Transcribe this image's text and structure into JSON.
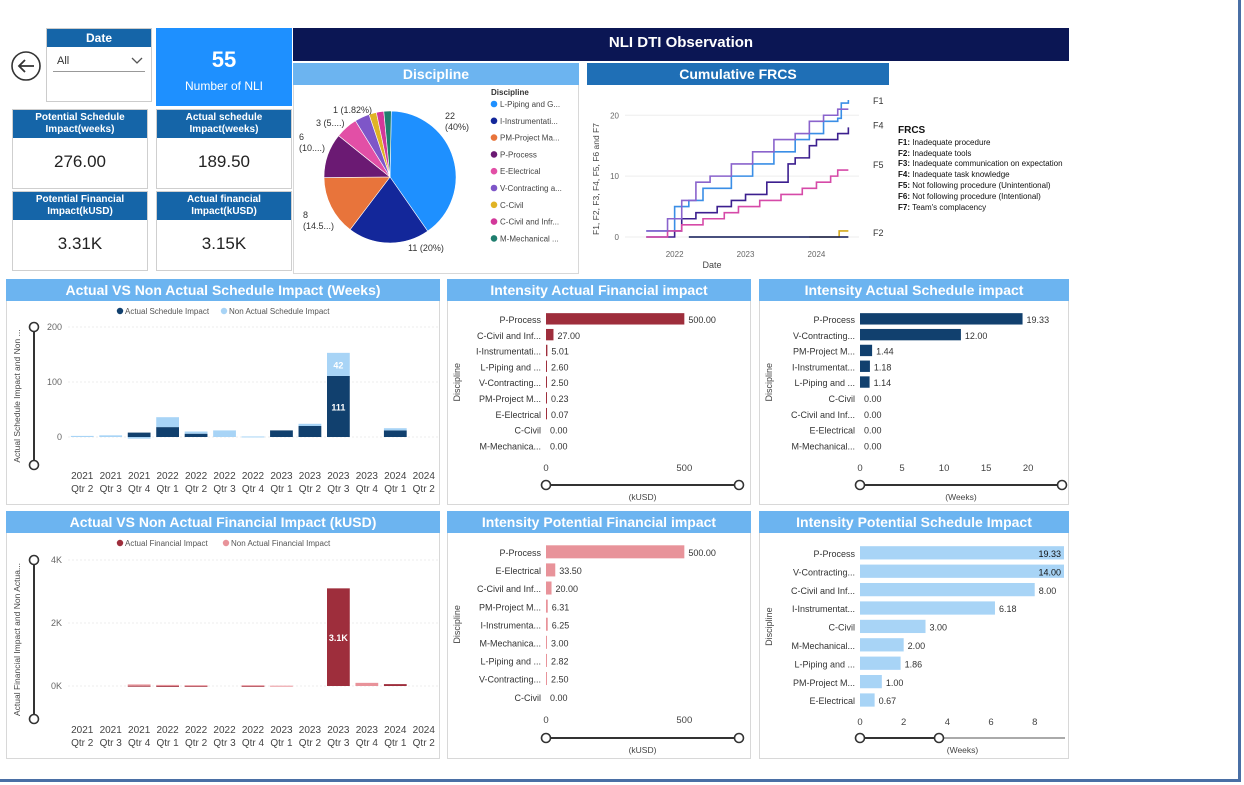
{
  "title": "NLI DTI Observation",
  "date_filter": {
    "label": "Date",
    "value": "All"
  },
  "nli": {
    "value": "55",
    "label": "Number of NLI"
  },
  "kpis": [
    {
      "title": "Potential Schedule Impact(weeks)",
      "value": "276.00"
    },
    {
      "title": "Actual schedule Impact(weeks)",
      "value": "189.50"
    },
    {
      "title": "Potential Financial Impact(kUSD)",
      "value": "3.31K"
    },
    {
      "title": "Actual financial Impact(kUSD)",
      "value": "3.15K"
    }
  ],
  "colors": {
    "navy": "#0b1654",
    "blue": "#1565a8",
    "light_blue": "#6cb4f0",
    "dark_bar": "#11406e",
    "pale_bar": "#a8d4f6",
    "wine": "#9e2e3c",
    "pink": "#e8939a"
  },
  "chart_data": [
    {
      "id": "discipline_pie",
      "type": "pie",
      "title": "Discipline",
      "legend_title": "Discipline",
      "legend_placement": "right",
      "slices": [
        {
          "name": "L-Piping and G...",
          "value": 22,
          "label": "22\n(40%)",
          "color": "#1e90ff"
        },
        {
          "name": "I-Instrumentati...",
          "value": 11,
          "label": "11 (20%)",
          "color": "#13279a"
        },
        {
          "name": "PM-Project Ma...",
          "value": 8,
          "label": "8\n(14.5...)",
          "color": "#e8743b"
        },
        {
          "name": "P-Process",
          "value": 6,
          "label": "6\n(10....)",
          "color": "#6b1a73"
        },
        {
          "name": "E-Electrical",
          "value": 3,
          "label": "3 (5....)",
          "color": "#e24fa6"
        },
        {
          "name": "V-Contracting a...",
          "value": 2,
          "label": "",
          "color": "#7e56c8"
        },
        {
          "name": "C-Civil",
          "value": 1,
          "label": "1 (1.82%)",
          "color": "#e0b324"
        },
        {
          "name": "C-Civil and Infr...",
          "value": 1,
          "label": "",
          "color": "#d2389a"
        },
        {
          "name": "M-Mechanical ...",
          "value": 1,
          "label": "",
          "color": "#1f7e6e"
        }
      ]
    },
    {
      "id": "cumulative_frcs",
      "type": "line",
      "title": "Cumulative FRCS",
      "xlabel": "Date",
      "ylabel": "F1, F2, F3, F4, F5, F6 and F7",
      "x_ticks": [
        "2022",
        "2023",
        "2024"
      ],
      "y_ticks": [
        0,
        10,
        20
      ],
      "ylim": [
        0,
        23
      ],
      "xlim": [
        2021.3,
        2024.6
      ],
      "series": [
        {
          "name": "F1",
          "color": "#3a8ee6",
          "points": [
            [
              2021.6,
              1
            ],
            [
              2021.9,
              1
            ],
            [
              2022.0,
              5
            ],
            [
              2022.2,
              6
            ],
            [
              2022.3,
              6
            ],
            [
              2022.4,
              8
            ],
            [
              2022.6,
              8
            ],
            [
              2022.8,
              10
            ],
            [
              2023.1,
              12
            ],
            [
              2023.4,
              14
            ],
            [
              2023.7,
              16
            ],
            [
              2023.9,
              17
            ],
            [
              2024.1,
              19
            ],
            [
              2024.3,
              19.5
            ],
            [
              2024.35,
              22
            ],
            [
              2024.45,
              22.5
            ]
          ]
        },
        {
          "name": "F4",
          "color": "#3c1f8f",
          "points": [
            [
              2021.6,
              0
            ],
            [
              2022.0,
              1
            ],
            [
              2022.1,
              3
            ],
            [
              2022.3,
              4
            ],
            [
              2022.6,
              5
            ],
            [
              2022.8,
              6
            ],
            [
              2023.0,
              7
            ],
            [
              2023.3,
              9
            ],
            [
              2023.6,
              12
            ],
            [
              2023.7,
              13
            ],
            [
              2023.9,
              15
            ],
            [
              2024.0,
              16
            ],
            [
              2024.3,
              17
            ],
            [
              2024.45,
              18
            ]
          ]
        },
        {
          "name": "F5",
          "color": "#d64aa8",
          "points": [
            [
              2021.6,
              0
            ],
            [
              2021.9,
              1
            ],
            [
              2022.1,
              2
            ],
            [
              2022.4,
              3
            ],
            [
              2022.7,
              4
            ],
            [
              2022.9,
              5
            ],
            [
              2023.2,
              6
            ],
            [
              2023.5,
              7
            ],
            [
              2023.8,
              8
            ],
            [
              2024.0,
              9
            ],
            [
              2024.2,
              10
            ],
            [
              2024.3,
              11
            ],
            [
              2024.45,
              11
            ]
          ]
        },
        {
          "name": "F7",
          "color": "#8a63cc",
          "points": [
            [
              2021.6,
              1
            ],
            [
              2021.9,
              3
            ],
            [
              2022.1,
              6
            ],
            [
              2022.3,
              9
            ],
            [
              2022.5,
              10
            ],
            [
              2022.8,
              12
            ],
            [
              2023.1,
              14
            ],
            [
              2023.4,
              16
            ],
            [
              2023.7,
              17
            ],
            [
              2023.9,
              19
            ],
            [
              2024.1,
              20
            ],
            [
              2024.3,
              21
            ],
            [
              2024.45,
              21
            ]
          ]
        },
        {
          "name": "F2",
          "color": "#d4a91c",
          "points": [
            [
              2023.9,
              0
            ],
            [
              2024.3,
              0
            ],
            [
              2024.32,
              1
            ],
            [
              2024.45,
              1
            ]
          ]
        },
        {
          "name": "F6",
          "color": "#0b1654",
          "points": [
            [
              2022.2,
              0
            ],
            [
              2024.45,
              0
            ]
          ]
        }
      ],
      "end_labels": [
        "F1",
        "F4",
        "F5",
        "F2"
      ]
    },
    {
      "id": "schedule_impact_weeks",
      "type": "bar",
      "title": "Actual VS Non Actual Schedule Impact (Weeks)",
      "ylabel": "Actual Schedule Impact and Non ...",
      "legend_placement": "top",
      "ylim": [
        -5,
        200
      ],
      "y_ticks": [
        0,
        100,
        200
      ],
      "categories": [
        [
          "2021",
          "Qtr 2"
        ],
        [
          "2021",
          "Qtr 3"
        ],
        [
          "2021",
          "Qtr 4"
        ],
        [
          "2022",
          "Qtr 1"
        ],
        [
          "2022",
          "Qtr 2"
        ],
        [
          "2022",
          "Qtr 3"
        ],
        [
          "2022",
          "Qtr 4"
        ],
        [
          "2023",
          "Qtr 1"
        ],
        [
          "2023",
          "Qtr 2"
        ],
        [
          "2023",
          "Qtr 3"
        ],
        [
          "2023",
          "Qtr 4"
        ],
        [
          "2024",
          "Qtr 1"
        ],
        [
          "2024",
          "Qtr 2"
        ]
      ],
      "series": [
        {
          "name": "Actual Schedule Impact",
          "color": "#11406e",
          "values": [
            0,
            0,
            8,
            18,
            6,
            0,
            0,
            12,
            20,
            111,
            0,
            12,
            0
          ]
        },
        {
          "name": "Non Actual Schedule Impact",
          "color": "#a8d4f6",
          "values": [
            2,
            3,
            -3,
            18,
            4,
            12,
            1,
            0,
            4,
            42,
            0,
            4,
            0
          ]
        }
      ],
      "data_labels": {
        "9": [
          "111",
          "42"
        ]
      }
    },
    {
      "id": "financial_impact_kusd",
      "type": "bar",
      "title": "Actual VS Non Actual Financial Impact (kUSD)",
      "ylabel": "Actual Financial Impact and Non Actua...",
      "legend_placement": "top",
      "ylim": [
        0,
        4000
      ],
      "y_ticks": [
        "0K",
        "2K",
        "4K"
      ],
      "categories": [
        [
          "2021",
          "Qtr 2"
        ],
        [
          "2021",
          "Qtr 3"
        ],
        [
          "2021",
          "Qtr 4"
        ],
        [
          "2022",
          "Qtr 1"
        ],
        [
          "2022",
          "Qtr 2"
        ],
        [
          "2022",
          "Qtr 3"
        ],
        [
          "2022",
          "Qtr 4"
        ],
        [
          "2023",
          "Qtr 1"
        ],
        [
          "2023",
          "Qtr 2"
        ],
        [
          "2023",
          "Qtr 3"
        ],
        [
          "2023",
          "Qtr 4"
        ],
        [
          "2024",
          "Qtr 1"
        ],
        [
          "2024",
          "Qtr 2"
        ]
      ],
      "series": [
        {
          "name": "Actual Financial  Impact",
          "color": "#9e2e3c",
          "values": [
            0,
            0,
            10,
            5,
            5,
            0,
            5,
            0,
            0,
            3100,
            0,
            60,
            0
          ]
        },
        {
          "name": "Non Actual Financial Impact",
          "color": "#e8939a",
          "values": [
            0,
            0,
            40,
            30,
            20,
            0,
            20,
            10,
            0,
            0,
            100,
            0,
            0
          ]
        }
      ],
      "data_labels": {
        "9": [
          "3.1K"
        ]
      }
    },
    {
      "id": "intensity_actual_financial",
      "type": "bar",
      "orientation": "horizontal",
      "title": "Intensity Actual Financial impact",
      "xlabel": "(kUSD)",
      "ylabel": "Discipline",
      "xlim": [
        0,
        600
      ],
      "x_ticks": [
        0,
        500
      ],
      "color": "#9e2e3c",
      "categories": [
        "P-Process",
        "C-Civil and Inf...",
        "I-Instrumentati...",
        "L-Piping and ...",
        "V-Contracting...",
        "PM-Project M...",
        "E-Electrical",
        "C-Civil",
        "M-Mechanica..."
      ],
      "values": [
        500.0,
        27.0,
        5.01,
        2.6,
        2.5,
        0.23,
        0.07,
        0.0,
        0.0
      ],
      "labels": [
        "500.00",
        "27.00",
        "5.01",
        "2.60",
        "2.50",
        "0.23",
        "0.07",
        "0.00",
        "0.00"
      ]
    },
    {
      "id": "intensity_actual_schedule",
      "type": "bar",
      "orientation": "horizontal",
      "title": "Intensity Actual Schedule impact",
      "xlabel": "(Weeks)",
      "ylabel": "Discipline",
      "xlim": [
        0,
        22
      ],
      "x_ticks": [
        0,
        5,
        10,
        15,
        20
      ],
      "color": "#11406e",
      "categories": [
        "P-Process",
        "V-Contracting...",
        "PM-Project M...",
        "I-Instrumentat...",
        "L-Piping and ...",
        "C-Civil",
        "C-Civil and Inf...",
        "E-Electrical",
        "M-Mechanical..."
      ],
      "values": [
        19.33,
        12.0,
        1.44,
        1.18,
        1.14,
        0.0,
        0.0,
        0.0,
        0.0
      ],
      "labels": [
        "19.33",
        "12.00",
        "1.44",
        "1.18",
        "1.14",
        "0.00",
        "0.00",
        "0.00",
        "0.00"
      ]
    },
    {
      "id": "intensity_potential_financial",
      "type": "bar",
      "orientation": "horizontal",
      "title": "Intensity Potential Financial impact",
      "xlabel": "(kUSD)",
      "ylabel": "Discipline",
      "xlim": [
        0,
        600
      ],
      "x_ticks": [
        0,
        500
      ],
      "color": "#e8939a",
      "categories": [
        "P-Process",
        "E-Electrical",
        "C-Civil and Inf...",
        "PM-Project M...",
        "I-Instrumenta...",
        "M-Mechanica...",
        "L-Piping and ...",
        "V-Contracting...",
        "C-Civil"
      ],
      "values": [
        500.0,
        33.5,
        20.0,
        6.31,
        6.25,
        3.0,
        2.82,
        2.5,
        0.0
      ],
      "labels": [
        "500.00",
        "33.50",
        "20.00",
        "6.31",
        "6.25",
        "3.00",
        "2.82",
        "2.50",
        "0.00"
      ]
    },
    {
      "id": "intensity_potential_schedule",
      "type": "bar",
      "orientation": "horizontal",
      "title": "Intensity Potential Schedule Impact",
      "xlabel": "(Weeks)",
      "ylabel": "Discipline",
      "xlim": [
        0,
        8.7
      ],
      "x_ticks": [
        0,
        2,
        4,
        6,
        8
      ],
      "color": "#a8d4f6",
      "categories": [
        "P-Process",
        "V-Contracting...",
        "C-Civil and Inf...",
        "I-Instrumentat...",
        "C-Civil",
        "M-Mechanical...",
        "L-Piping and ...",
        "PM-Project M...",
        "E-Electrical"
      ],
      "values": [
        19.33,
        14.0,
        8.0,
        6.18,
        3.0,
        2.0,
        1.86,
        1.0,
        0.67
      ],
      "labels": [
        "19.33",
        "14.00",
        "8.00",
        "6.18",
        "3.00",
        "2.00",
        "1.86",
        "1.00",
        "0.67"
      ]
    }
  ],
  "frcs_legend": {
    "title": "FRCS",
    "items": [
      {
        "key": "F1:",
        "text": "Inadequate procedure"
      },
      {
        "key": "F2:",
        "text": "Inadequate tools"
      },
      {
        "key": "F3:",
        "text": "Inadequate communication on expectation"
      },
      {
        "key": "F4:",
        "text": "Inadequate task knowledge"
      },
      {
        "key": "F5:",
        "text": "Not following procedure (Unintentional)"
      },
      {
        "key": "F6:",
        "text": "Not following procedure (Intentional)"
      },
      {
        "key": "F7:",
        "text": "Team's complacency"
      }
    ]
  }
}
